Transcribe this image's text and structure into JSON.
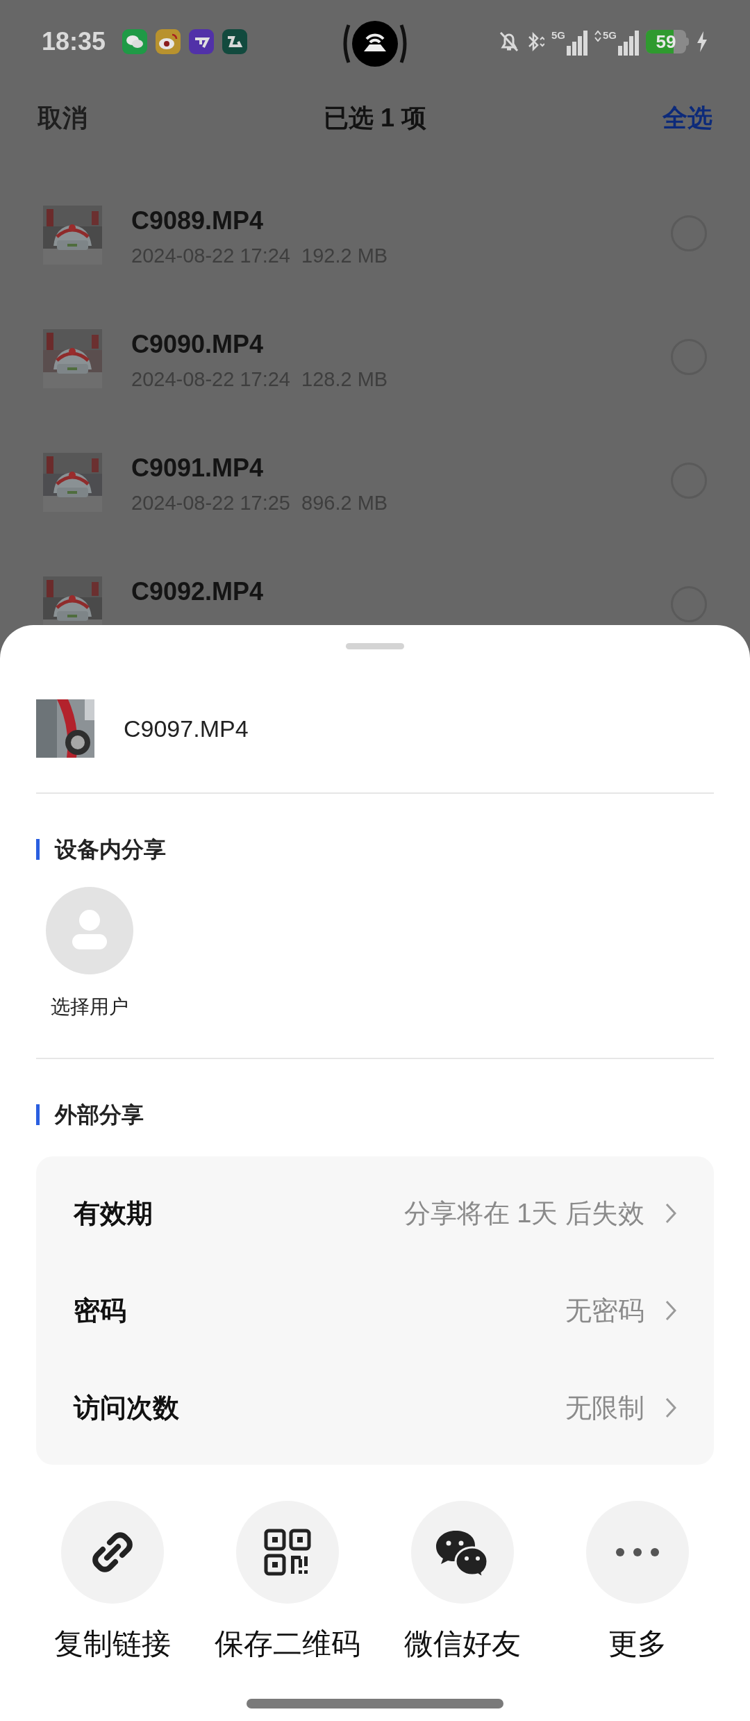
{
  "status_bar": {
    "time": "18:35",
    "network_labels": [
      "5G",
      "5G"
    ],
    "battery": "59"
  },
  "header": {
    "cancel": "取消",
    "title": "已选 1 项",
    "select_all": "全选"
  },
  "files": [
    {
      "name": "C9089.MP4",
      "meta": "2024-08-22 17:24  192.2 MB",
      "selected": false
    },
    {
      "name": "C9090.MP4",
      "meta": "2024-08-22 17:24  128.2 MB",
      "selected": false
    },
    {
      "name": "C9091.MP4",
      "meta": "2024-08-22 17:25  896.2 MB",
      "selected": false
    },
    {
      "name": "C9092.MP4",
      "selected": false
    }
  ],
  "share_sheet": {
    "file_name": "C9097.MP4",
    "device_section": {
      "title": "设备内分享",
      "target": "选择用户"
    },
    "external_section": {
      "title": "外部分享",
      "settings": [
        {
          "label": "有效期",
          "value": "分享将在 1天 后失效"
        },
        {
          "label": "密码",
          "value": "无密码"
        },
        {
          "label": "访问次数",
          "value": "无限制"
        }
      ]
    },
    "actions": [
      {
        "kind": "link",
        "label": "复制链接"
      },
      {
        "kind": "qr",
        "label": "保存二维码"
      },
      {
        "kind": "wechat",
        "label": "微信好友"
      },
      {
        "kind": "more",
        "label": "更多"
      }
    ]
  }
}
